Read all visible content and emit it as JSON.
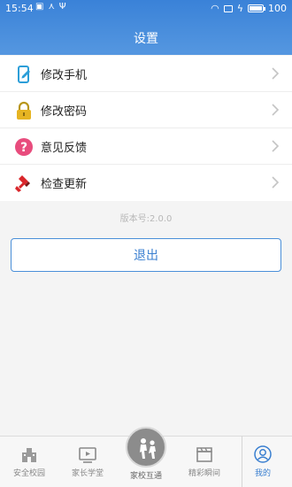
{
  "status_bar": {
    "time": "15:54",
    "battery": "100"
  },
  "header": {
    "title": "设置"
  },
  "menu": [
    {
      "label": "修改手机",
      "icon": "phone-edit-icon"
    },
    {
      "label": "修改密码",
      "icon": "lock-icon"
    },
    {
      "label": "意见反馈",
      "icon": "question-icon"
    },
    {
      "label": "检查更新",
      "icon": "brush-icon"
    }
  ],
  "version": "版本号:2.0.0",
  "logout_label": "退出",
  "tabs": [
    {
      "label": "安全校园",
      "icon": "school-building-icon"
    },
    {
      "label": "家长学堂",
      "icon": "video-class-icon"
    },
    {
      "label": "家校互通",
      "icon": "parent-child-icon"
    },
    {
      "label": "精彩瞬间",
      "icon": "clapperboard-icon"
    },
    {
      "label": "我的",
      "icon": "profile-icon"
    }
  ],
  "colors": {
    "header": "#3a82d8",
    "accent": "#3a7fd0",
    "lock": "#e6b422",
    "question": "#e84c7d",
    "brush": "#d9262b"
  }
}
